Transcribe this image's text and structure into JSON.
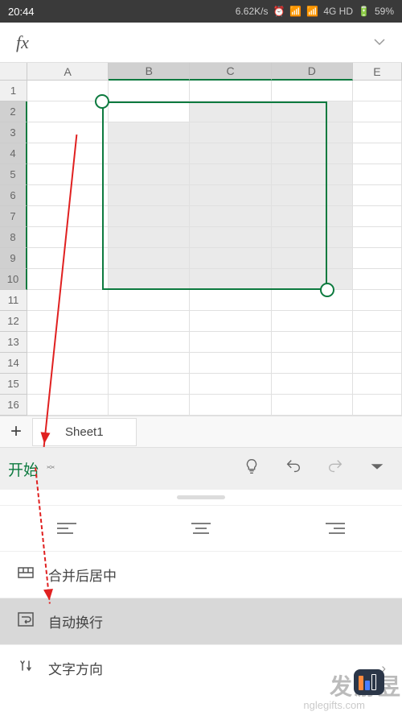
{
  "status": {
    "time": "20:44",
    "speed": "6.62K/s",
    "network": "4G HD",
    "battery": "59%"
  },
  "formula": {
    "fx": "fx"
  },
  "grid": {
    "cols": [
      "A",
      "B",
      "C",
      "D",
      "E"
    ],
    "rows": [
      "1",
      "2",
      "3",
      "4",
      "5",
      "6",
      "7",
      "8",
      "9",
      "10",
      "11",
      "12",
      "13",
      "14",
      "15",
      "16"
    ],
    "selected_cols": [
      "B",
      "C",
      "D"
    ],
    "selected_rows": [
      "2",
      "3",
      "4",
      "5",
      "6",
      "7",
      "8",
      "9",
      "10"
    ],
    "selection_range": "B2:D10"
  },
  "tabs": {
    "sheet1": "Sheet1"
  },
  "toolbar": {
    "start": "开始"
  },
  "options": {
    "align_left": "左对齐",
    "align_center": "居中",
    "align_right": "右对齐",
    "merge_center": "合并后居中",
    "wrap_text": "自动换行",
    "text_direction": "文字方向"
  },
  "watermark": {
    "text": "发游昱",
    "domain": "nglegifts.com"
  }
}
